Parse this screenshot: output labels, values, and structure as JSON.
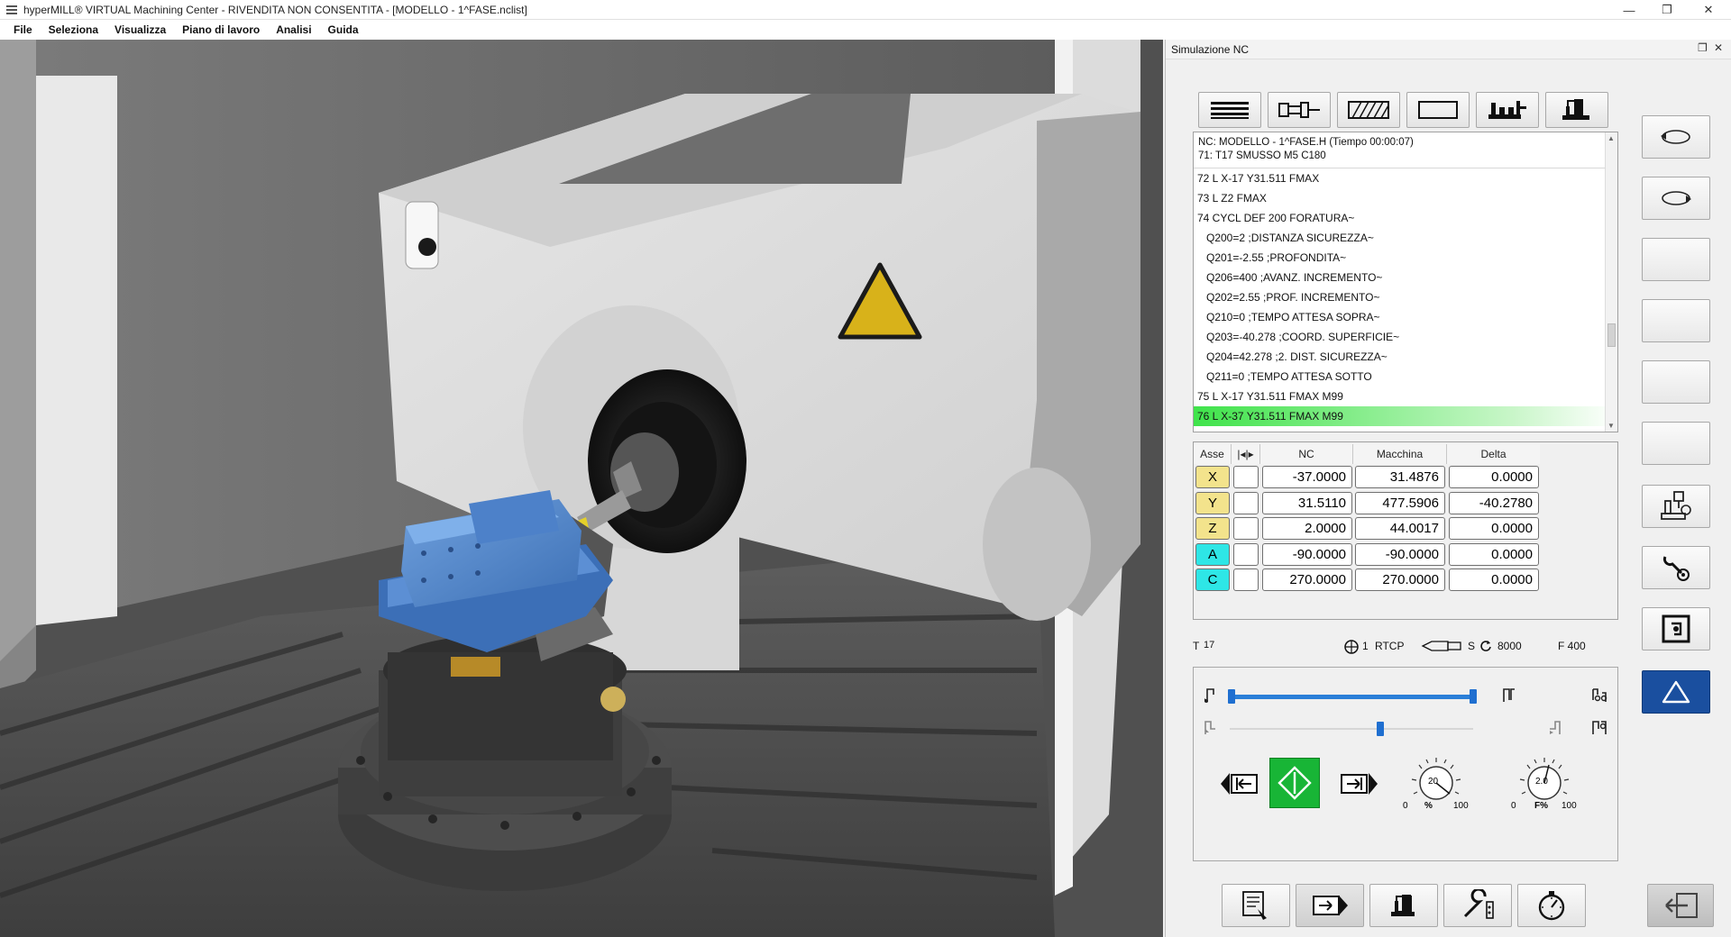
{
  "window": {
    "title": "hyperMILL® VIRTUAL Machining Center - RIVENDITA NON CONSENTITA - [MODELLO - 1^FASE.nclist]",
    "minimize": "—",
    "restore": "❐",
    "close": "✕"
  },
  "menu": [
    "File",
    "Seleziona",
    "Visualizza",
    "Piano di lavoro",
    "Analisi",
    "Guida"
  ],
  "panel": {
    "title": "Simulazione NC",
    "pin_icon": "❐",
    "close_icon": "✕"
  },
  "toolbar_icons": [
    "nc-list-icon",
    "tool-icon",
    "stock-icon",
    "blank-icon",
    "machine-icon",
    "fixture-icon"
  ],
  "nclist": {
    "header_line1": "NC: MODELLO - 1^FASE.H (Tiempo 00:00:07)",
    "header_line2": "71: T17 SMUSSO M5 C180",
    "lines": [
      {
        "text": "72 L X-17 Y31.511 FMAX",
        "indent": false,
        "highlight": false
      },
      {
        "text": "73 L Z2 FMAX",
        "indent": false,
        "highlight": false
      },
      {
        "text": "74 CYCL DEF 200 FORATURA~",
        "indent": false,
        "highlight": false
      },
      {
        "text": "Q200=2 ;DISTANZA SICUREZZA~",
        "indent": true,
        "highlight": false
      },
      {
        "text": "Q201=-2.55 ;PROFONDITA~",
        "indent": true,
        "highlight": false
      },
      {
        "text": "Q206=400 ;AVANZ. INCREMENTO~",
        "indent": true,
        "highlight": false
      },
      {
        "text": "Q202=2.55 ;PROF. INCREMENTO~",
        "indent": true,
        "highlight": false
      },
      {
        "text": "Q210=0 ;TEMPO ATTESA SOPRA~",
        "indent": true,
        "highlight": false
      },
      {
        "text": "Q203=-40.278 ;COORD. SUPERFICIE~",
        "indent": true,
        "highlight": false
      },
      {
        "text": "Q204=42.278 ;2. DIST. SICUREZZA~",
        "indent": true,
        "highlight": false
      },
      {
        "text": "Q211=0 ;TEMPO ATTESA SOTTO",
        "indent": true,
        "highlight": false
      },
      {
        "text": "75 L X-17 Y31.511 FMAX M99",
        "indent": false,
        "highlight": false
      },
      {
        "text": "76 L X-37 Y31.511 FMAX M99",
        "indent": false,
        "highlight": true
      }
    ]
  },
  "axes_table": {
    "headers": {
      "axis": "Asse",
      "mark": "|◂|▸",
      "nc": "NC",
      "machine": "Macchina",
      "delta": "Delta"
    },
    "rows": [
      {
        "axis": "X",
        "color": "#f3e38c",
        "nc": "-37.0000",
        "machine": "31.4876",
        "delta": "0.0000"
      },
      {
        "axis": "Y",
        "color": "#f3e38c",
        "nc": "31.5110",
        "machine": "477.5906",
        "delta": "-40.2780"
      },
      {
        "axis": "Z",
        "color": "#f3e38c",
        "nc": "2.0000",
        "machine": "44.0017",
        "delta": "0.0000"
      },
      {
        "axis": "A",
        "color": "#2ee6e6",
        "nc": "-90.0000",
        "machine": "-90.0000",
        "delta": "0.0000"
      },
      {
        "axis": "C",
        "color": "#2ee6e6",
        "nc": "270.0000",
        "machine": "270.0000",
        "delta": "0.0000"
      }
    ]
  },
  "status": {
    "tool_label": "T",
    "tool_number": "17",
    "plane_number": "1",
    "rtcp": "RTCP",
    "spindle_label": "S",
    "spindle_speed": "8000",
    "feed": "F 400"
  },
  "playback": {
    "progress_fraction": 1.0,
    "speed_fraction": 0.62,
    "speed_knob": {
      "value": "20",
      "min": "0",
      "max": "100",
      "label": "%"
    },
    "feed_knob": {
      "value": "2.0",
      "min": "0",
      "max": "100",
      "label": "F%"
    }
  },
  "side_buttons": [
    "rotate-left-icon",
    "rotate-right-icon",
    "empty",
    "empty",
    "empty",
    "empty",
    "machine-tool-icon",
    "settings-wrench-icon",
    "frame-icon",
    "warning-triangle-icon"
  ],
  "bottom_buttons": [
    "nc-program-icon",
    "next-arrow-icon",
    "machine-icon",
    "tool-wrench-icon",
    "stopwatch-icon",
    "exit-icon"
  ]
}
